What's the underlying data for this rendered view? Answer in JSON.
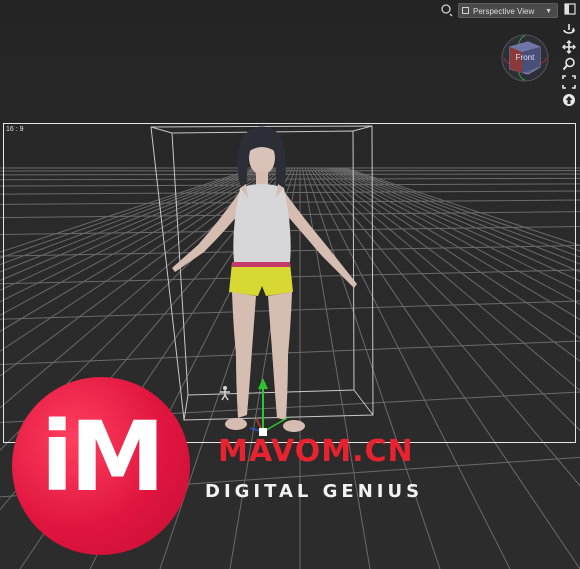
{
  "viewport": {
    "aspect_label": "16 : 9",
    "view_mode": "Perspective View"
  },
  "view_cube": {
    "face_label": "Front"
  },
  "toolbar": {
    "icons": [
      "visibility-toggle-icon",
      "panel-menu-icon"
    ],
    "side_icons": [
      "orbit-icon",
      "pan-icon",
      "zoom-icon",
      "frame-icon",
      "home-icon"
    ]
  },
  "watermark": {
    "logo": "iM",
    "url": "MAVOM.CN",
    "tagline": "DIGITAL GENIUS"
  },
  "colors": {
    "background": "#2b2b2b",
    "grid": "#6a6a6a",
    "shorts": "#d8d832",
    "logo_red": "#e0153f",
    "url_red": "#e8232f"
  }
}
